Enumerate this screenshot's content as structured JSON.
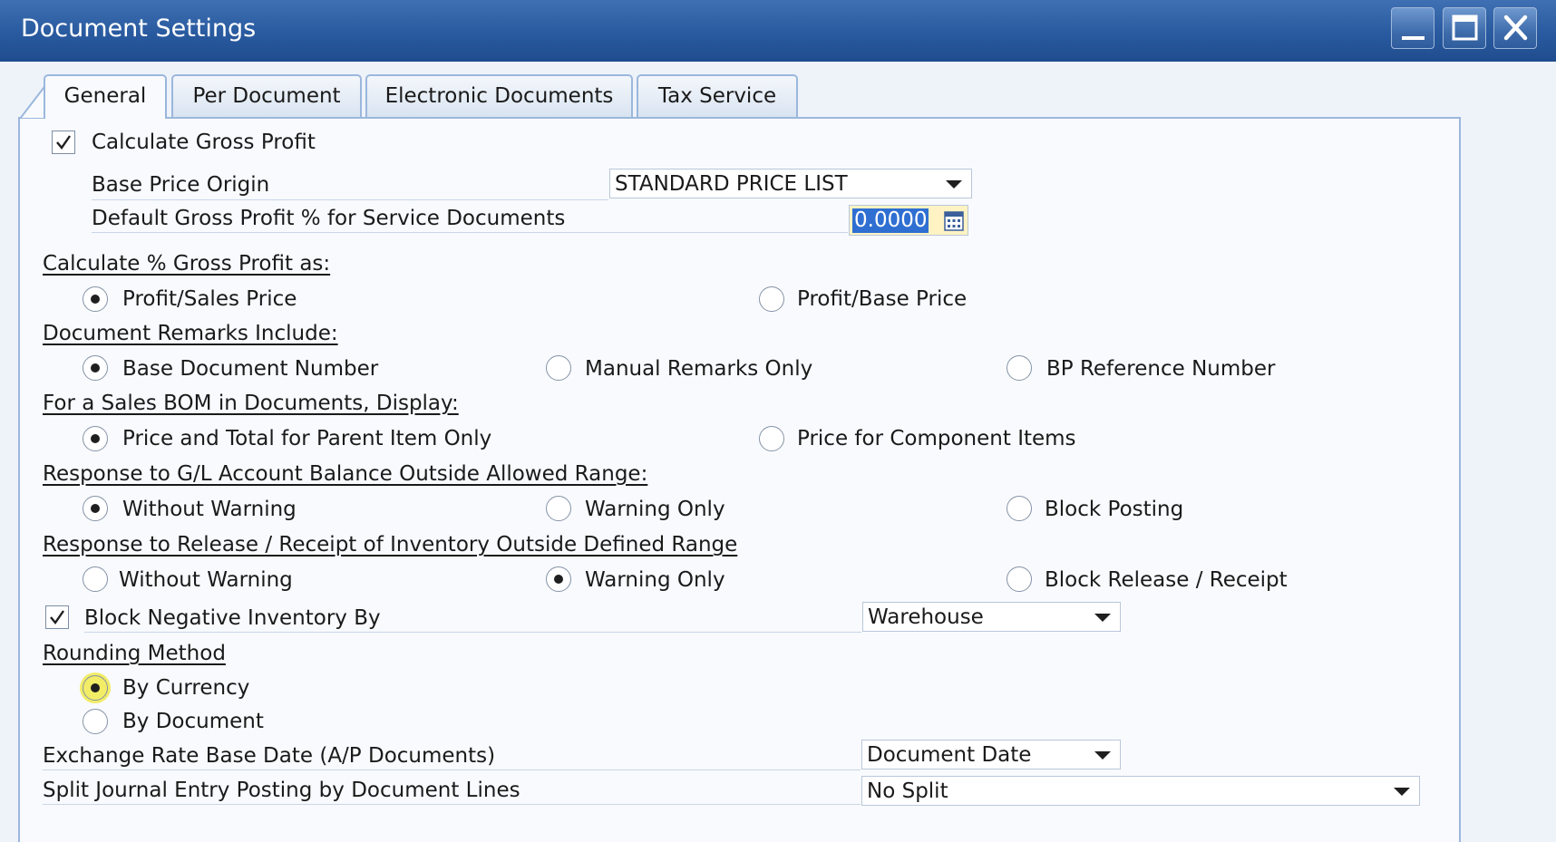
{
  "window": {
    "title": "Document Settings",
    "controls": [
      "minimize",
      "maximize",
      "close"
    ]
  },
  "tabs": [
    {
      "label": "General",
      "active": true
    },
    {
      "label": "Per Document",
      "active": false
    },
    {
      "label": "Electronic Documents",
      "active": false
    },
    {
      "label": "Tax Service",
      "active": false
    }
  ],
  "general": {
    "calculate_gross_profit": {
      "label": "Calculate Gross Profit",
      "checked": true
    },
    "base_price_origin": {
      "label": "Base Price Origin",
      "value": "STANDARD PRICE LIST"
    },
    "default_gross_profit": {
      "label": "Default Gross Profit % for Service Documents",
      "value": "0.0000"
    },
    "gross_profit_as": {
      "heading": "Calculate % Gross Profit as:",
      "options": [
        "Profit/Sales Price",
        "Profit/Base Price"
      ],
      "selected": "Profit/Sales Price"
    },
    "document_remarks": {
      "heading": "Document Remarks Include:",
      "options": [
        "Base Document Number",
        "Manual Remarks Only",
        "BP Reference Number"
      ],
      "selected": "Base Document Number"
    },
    "sales_bom": {
      "heading": "For a Sales BOM in Documents, Display:",
      "options": [
        "Price and Total for Parent Item Only",
        "Price for Component Items"
      ],
      "selected": "Price and Total for Parent Item Only"
    },
    "gl_balance": {
      "heading": "Response to G/L Account Balance Outside Allowed Range:",
      "options": [
        "Without Warning",
        "Warning Only",
        "Block Posting"
      ],
      "selected": "Without Warning"
    },
    "inventory_release": {
      "heading": "Response to Release / Receipt of Inventory Outside Defined Range",
      "options": [
        "Without Warning",
        "Warning Only",
        "Block Release / Receipt"
      ],
      "selected": "Warning Only"
    },
    "block_negative_inventory": {
      "label": "Block Negative Inventory By",
      "checked": true,
      "value": "Warehouse"
    },
    "rounding_method": {
      "heading": "Rounding Method",
      "options": [
        "By Currency",
        "By Document"
      ],
      "selected": "By Currency"
    },
    "exchange_rate_date": {
      "label": "Exchange Rate Base Date (A/P Documents)",
      "value": "Document Date"
    },
    "split_journal": {
      "label": "Split Journal Entry Posting by Document Lines",
      "value": "No Split"
    }
  },
  "colors": {
    "titlebar": "#295a9f",
    "tab_border": "#9bb7dc",
    "selection": "#2f6fd1",
    "highlight": "#f2ec66"
  }
}
